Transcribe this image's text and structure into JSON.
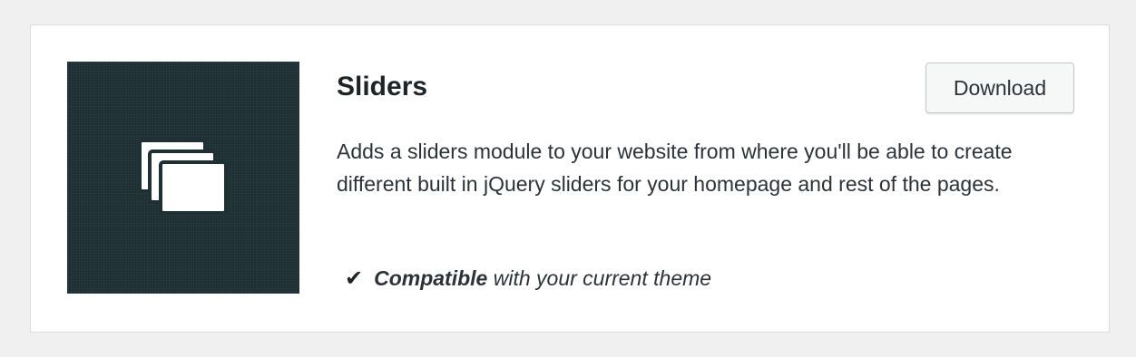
{
  "plugin": {
    "name": "Sliders",
    "description": "Adds a sliders module to your website from where you'll be able to create different built in jQuery sliders for your homepage and rest of the pages.",
    "download_label": "Download",
    "compat_check": "✔",
    "compat_strong": "Compatible",
    "compat_rest": " with your current theme",
    "thumbnail_icon": "stacked-slides-icon"
  },
  "colors": {
    "thumbnail_bg": "#1f3034",
    "page_bg": "#f0f0f1",
    "card_bg": "#ffffff"
  }
}
